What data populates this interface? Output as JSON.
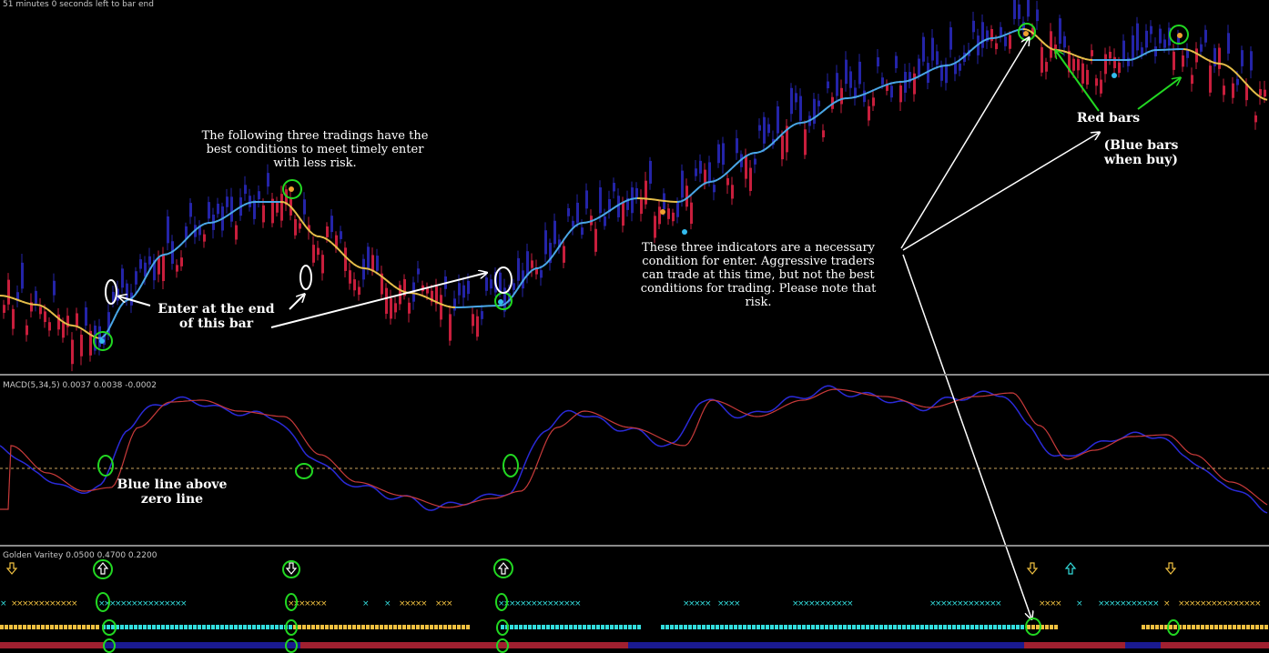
{
  "header": {
    "status": "51 minutes 0 seconds left to bar end"
  },
  "panels": {
    "macd_label": "MACD(5,34,5) 0.0037 0.0038 -0.0002",
    "golden_label": "Golden Varitey 0.0500 0.4700 0.2200"
  },
  "annotations": {
    "three_tradings": "The following three tradings have the\nbest conditions to meet timely enter\nwith less risk.",
    "enter_bar": "Enter at the end\nof this bar",
    "three_indicators": "These three indicators are a necessary\ncondition for enter. Aggressive traders\ncan trade at this time, but not the best\nconditions for trading. Please note that\nrisk.",
    "red_bars": "Red bars",
    "blue_bars": "(Blue bars\nwhen buy)",
    "blue_line_zero": "Blue line above\nzero line"
  },
  "colors": {
    "background": "#000000",
    "bull_bar": "#2424a8",
    "bear_bar": "#c81e3c",
    "ma_up": "#4aa8e8",
    "ma_down": "#e8c04a",
    "macd_main": "#2a2ad8",
    "macd_signal": "#c83a3a",
    "highlight_circle": "#22d822",
    "cyan_marker": "#33dddd",
    "yellow_marker": "#f0c040"
  },
  "icons": [
    "arrow-down-icon",
    "arrow-up-icon",
    "x-marker-icon"
  ]
}
